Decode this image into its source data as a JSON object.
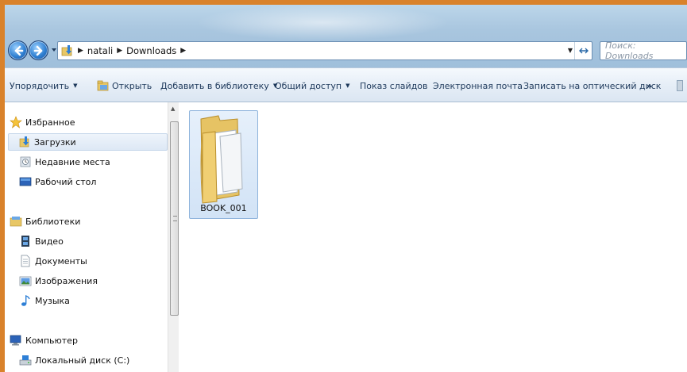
{
  "address": {
    "crumbs": [
      "natali",
      "Downloads"
    ]
  },
  "search": {
    "placeholder": "Поиск: Downloads"
  },
  "toolbar": {
    "organize": "Упорядочить",
    "open": "Открыть",
    "add_to_library": "Добавить в библиотеку",
    "share": "Общий доступ",
    "slideshow": "Показ слайдов",
    "email": "Электронная почта",
    "burn": "Записать на оптический диск",
    "more": "»"
  },
  "nav": {
    "favorites": "Избранное",
    "downloads": "Загрузки",
    "recent": "Недавние места",
    "desktop": "Рабочий стол",
    "libraries": "Библиотеки",
    "video": "Видео",
    "documents": "Документы",
    "pictures": "Изображения",
    "music": "Музыка",
    "computer": "Компьютер",
    "local_disk": "Локальный диск (C:)"
  },
  "files": [
    {
      "name": "BOOK_001",
      "type": "folder"
    }
  ]
}
